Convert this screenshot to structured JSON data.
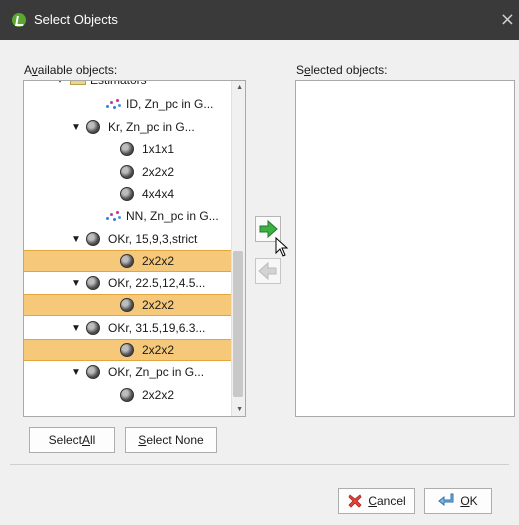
{
  "window": {
    "title": "Select Objects",
    "close_glyph": "×"
  },
  "labels": {
    "available_prefix": "A",
    "available_key": "v",
    "available_rest": "ailable objects:",
    "selected_prefix": "S",
    "selected_key": "e",
    "selected_rest": "lected objects:"
  },
  "tree": {
    "rows": [
      {
        "label": "Estimators",
        "icon": "folder-icon",
        "expander": "▾",
        "selected": false
      },
      {
        "label": "ID, Zn_pc in G...",
        "icon": "scatter-points-icon",
        "expander": "",
        "selected": false
      },
      {
        "label": "Kr, Zn_pc in G...",
        "icon": "block-model-orb-icon",
        "expander": "▼",
        "selected": false
      },
      {
        "label": "1x1x1",
        "icon": "block-model-orb-icon",
        "expander": "",
        "selected": false
      },
      {
        "label": "2x2x2",
        "icon": "block-model-orb-icon",
        "expander": "",
        "selected": false
      },
      {
        "label": "4x4x4",
        "icon": "block-model-orb-icon",
        "expander": "",
        "selected": false
      },
      {
        "label": "NN, Zn_pc in G...",
        "icon": "scatter-points-icon",
        "expander": "",
        "selected": false
      },
      {
        "label": "OKr, 15,9,3,strict",
        "icon": "block-model-orb-icon",
        "expander": "▼",
        "selected": false
      },
      {
        "label": "2x2x2",
        "icon": "block-model-orb-icon",
        "expander": "",
        "selected": true
      },
      {
        "label": "OKr, 22.5,12,4.5...",
        "icon": "block-model-orb-icon",
        "expander": "▼",
        "selected": false
      },
      {
        "label": "2x2x2",
        "icon": "block-model-orb-icon",
        "expander": "",
        "selected": true
      },
      {
        "label": "OKr, 31.5,19,6.3...",
        "icon": "block-model-orb-icon",
        "expander": "▼",
        "selected": false
      },
      {
        "label": "2x2x2",
        "icon": "block-model-orb-icon",
        "expander": "",
        "selected": true
      },
      {
        "label": "OKr, Zn_pc in G...",
        "icon": "block-model-orb-icon",
        "expander": "▼",
        "selected": false
      },
      {
        "label": "2x2x2",
        "icon": "block-model-orb-icon",
        "expander": "",
        "selected": false
      }
    ]
  },
  "buttons": {
    "select_all_prefix": "Select ",
    "select_all_key": "A",
    "select_all_rest": "ll",
    "select_none_prefix": "",
    "select_none_key": "S",
    "select_none_rest": "elect None",
    "cancel_key": "C",
    "cancel_rest": "ancel",
    "ok_key": "O",
    "ok_rest": "K"
  },
  "colors": {
    "titlebar": "#3a3a3a",
    "selection": "#f6c87a",
    "add_arrow": "#3cb043",
    "remove_arrow": "#c8c8c8"
  }
}
